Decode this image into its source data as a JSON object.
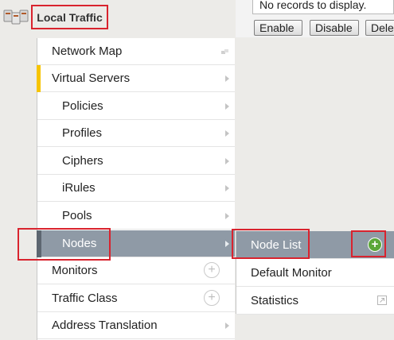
{
  "header": {
    "title": "Local Traffic",
    "icon": "network-icon"
  },
  "content": {
    "no_records": "No records to display.",
    "buttons": [
      "Enable",
      "Disable",
      "Dele"
    ]
  },
  "menu": {
    "items": [
      {
        "label": "Network Map",
        "indicator": "pin-icon"
      },
      {
        "label": "Virtual Servers",
        "indicator": "chevron-right-icon",
        "active": true
      },
      {
        "label": "Policies",
        "indicator": "chevron-right-icon"
      },
      {
        "label": "Profiles",
        "indicator": "chevron-right-icon"
      },
      {
        "label": "Ciphers",
        "indicator": "chevron-right-icon"
      },
      {
        "label": "iRules",
        "indicator": "chevron-right-icon"
      },
      {
        "label": "Pools",
        "indicator": "chevron-right-icon"
      },
      {
        "label": "Nodes",
        "indicator": "chevron-right-icon",
        "selected": true
      },
      {
        "label": "Monitors",
        "indicator": "plus-circle-icon"
      },
      {
        "label": "Traffic Class",
        "indicator": "plus-circle-icon"
      },
      {
        "label": "Address Translation",
        "indicator": "chevron-right-icon"
      }
    ]
  },
  "submenu": {
    "items": [
      {
        "label": "Node List",
        "indicator": "add-green-icon",
        "selected": true
      },
      {
        "label": "Default Monitor"
      },
      {
        "label": "Statistics",
        "indicator": "external-link-icon"
      }
    ]
  },
  "colors": {
    "highlight_border": "#d9232e",
    "selected_bg": "#8f9aa6",
    "active_bar": "#f6c400",
    "add_green": "#5ba739"
  }
}
